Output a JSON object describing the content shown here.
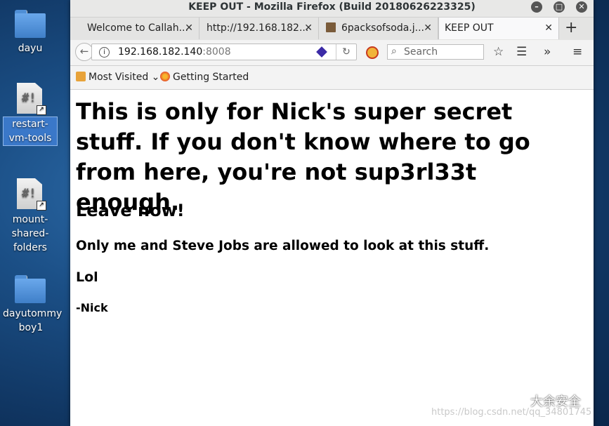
{
  "desktop": {
    "icons": [
      {
        "label": "dayu",
        "type": "folder"
      },
      {
        "label": "restart-vm-tools",
        "type": "script",
        "selected": true
      },
      {
        "label": "mount-shared-folders",
        "type": "script"
      },
      {
        "label": "dayutommy boy1",
        "type": "folder"
      }
    ]
  },
  "window": {
    "title": "KEEP OUT - Mozilla Firefox (Build 20180626223325)",
    "tabs": [
      {
        "label": "Welcome to Callah..."
      },
      {
        "label": "http://192.168.182..."
      },
      {
        "label": "6packsofsoda.j..."
      },
      {
        "label": "KEEP OUT",
        "active": true
      }
    ],
    "url": {
      "host": "192.168.182.140",
      "port": ":8008"
    },
    "search_placeholder": "Search",
    "bookmarks": [
      "Most Visited",
      "Getting Started"
    ]
  },
  "page": {
    "heading": "This is only for Nick's super secret stuff. If you don't know where to go from here, you're not sup3rl33t enough.",
    "leave": "Leave now!",
    "only": "Only me and Steve Jobs are allowed to look at this stuff.",
    "lol": "Lol",
    "sign": "-Nick"
  },
  "watermark": {
    "text": "大余安全",
    "url": "https://blog.csdn.net/qq_34801745"
  },
  "colors": {
    "desktop": "#1b4f86",
    "selection": "#3a78c9"
  }
}
